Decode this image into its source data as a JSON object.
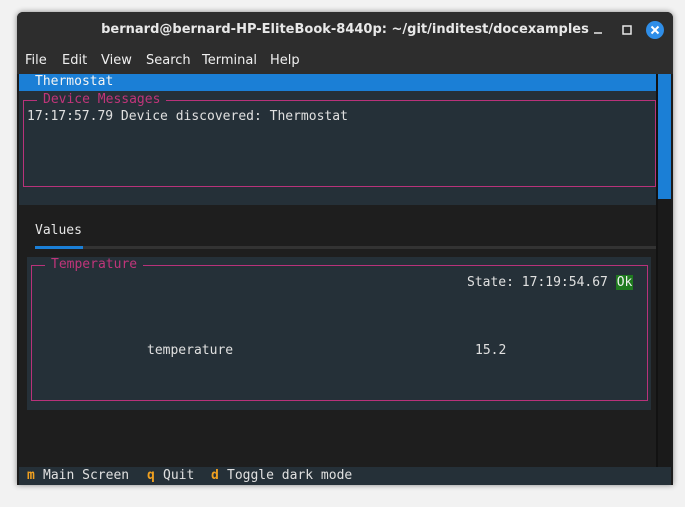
{
  "window": {
    "title": "bernard@bernard-HP-EliteBook-8440p: ~/git/inditest/docexamples"
  },
  "menu": [
    "File",
    "Edit",
    "View",
    "Search",
    "Terminal",
    "Help"
  ],
  "device": {
    "name": "Thermostat"
  },
  "messages": {
    "legend": "Device Messages",
    "lines": [
      "17:17:57.79  Device discovered: Thermostat"
    ]
  },
  "tabs": [
    {
      "label": "Values"
    }
  ],
  "vector": {
    "legend": "Temperature",
    "state_label": "State: 17:19:54.67",
    "state_value": "Ok",
    "member_label": "temperature",
    "member_value": "15.2"
  },
  "footer": [
    {
      "key": "m",
      "label": "Main Screen"
    },
    {
      "key": "q",
      "label": "Quit"
    },
    {
      "key": "d",
      "label": "Toggle dark mode"
    }
  ],
  "colors": {
    "accent": "#1b7fd6",
    "border": "#b8327a",
    "ok": "#1f7a1f",
    "key": "#f0a020"
  }
}
